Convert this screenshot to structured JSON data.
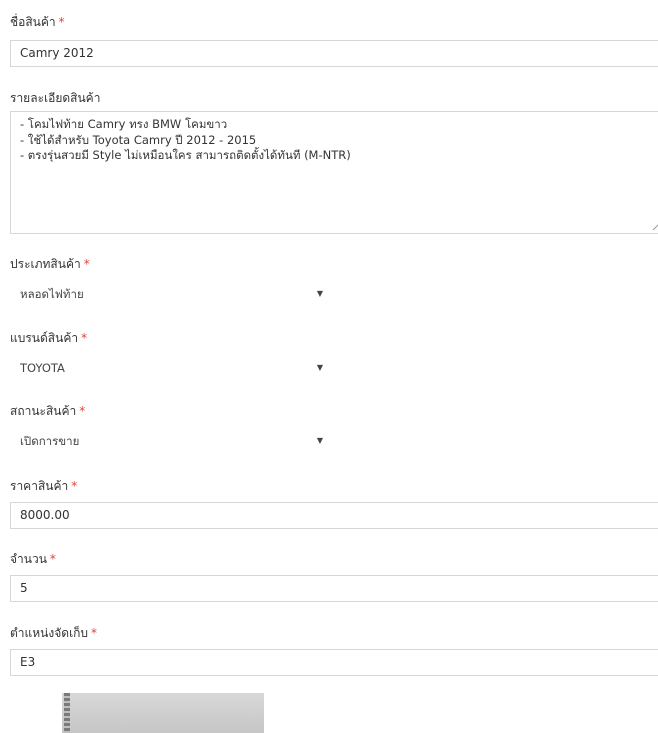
{
  "required_mark": "*",
  "colors": {
    "required": "#e0443c",
    "border": "#d7d7d7",
    "text": "#333333"
  },
  "name": {
    "label": "ชื่อสินค้า",
    "value": "Camry 2012"
  },
  "description": {
    "label": "รายละเอียดสินค้า",
    "lines": [
      "- โคมไฟท้าย Camry ทรง BMW โคมขาว",
      "- ใช้ได้สำหรับ Toyota Camry ปี 2012 - 2015",
      "- ตรงรุ่นสวยมี Style ไม่เหมือนใคร สามารถติดตั้งได้ทันที (M-NTR)"
    ]
  },
  "category": {
    "label": "ประเภทสินค้า",
    "value": "หลอดไฟท้าย",
    "icon": "chevron-down-icon"
  },
  "brand": {
    "label": "แบรนด์สินค้า",
    "value": "TOYOTA",
    "icon": "chevron-down-icon"
  },
  "status": {
    "label": "สถานะสินค้า",
    "value": "เปิดการขาย",
    "icon": "chevron-down-icon"
  },
  "price": {
    "label": "ราคาสินค้า",
    "value": "8000.00"
  },
  "quantity": {
    "label": "จำนวน",
    "value": "5"
  },
  "location": {
    "label": "ตำแหน่งจัดเก็บ",
    "value": "E3"
  },
  "chevron_glyph": "▼"
}
